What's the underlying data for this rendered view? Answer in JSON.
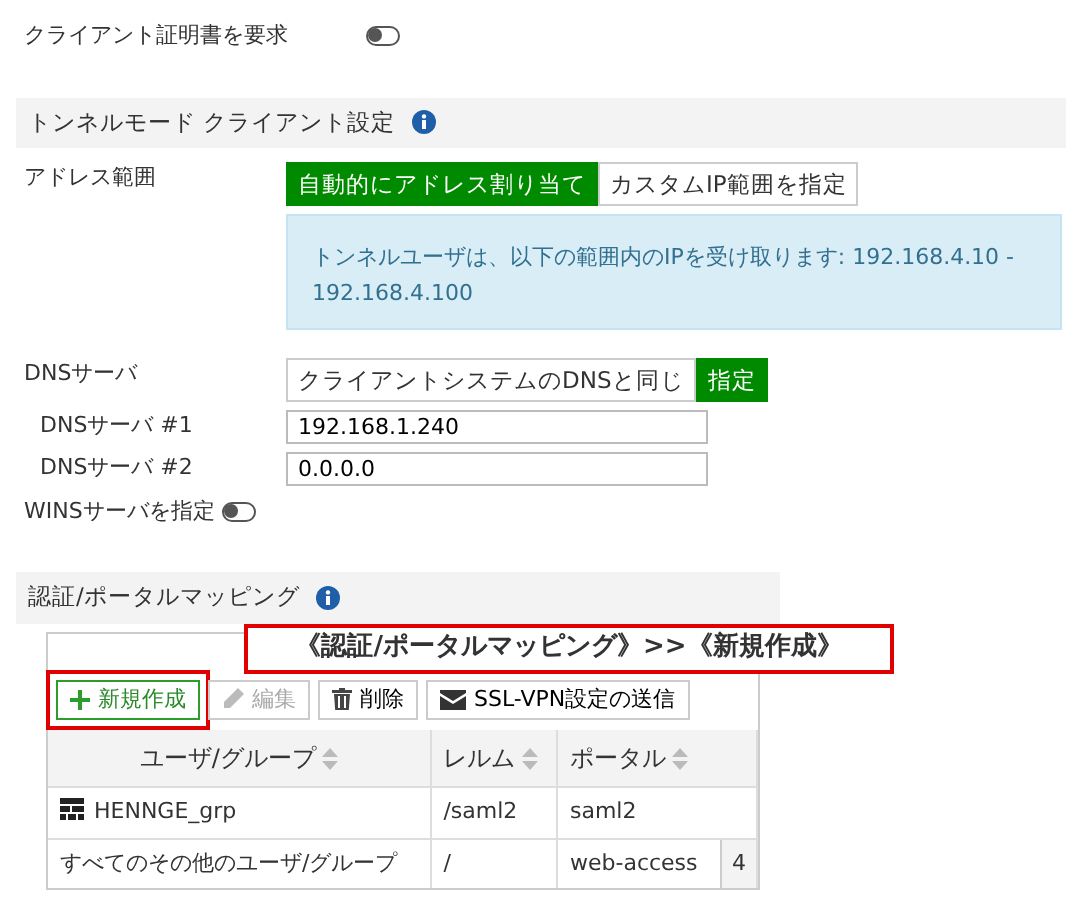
{
  "client_cert": {
    "label": "クライアント証明書を要求",
    "on": false
  },
  "tunnel_section": {
    "title": "トンネルモード クライアント設定"
  },
  "address_range": {
    "label": "アドレス範囲",
    "options": [
      {
        "label": "自動的にアドレス割り当て",
        "selected": true
      },
      {
        "label": "カスタムIP範囲を指定",
        "selected": false
      }
    ],
    "info": "トンネルユーザは、以下の範囲内のIPを受け取ります: 192.168.4.10 - 192.168.4.100"
  },
  "dns": {
    "label": "DNSサーバ",
    "options": [
      {
        "label": "クライアントシステムのDNSと同じ",
        "selected": false
      },
      {
        "label": "指定",
        "selected": true
      }
    ],
    "servers": [
      {
        "label": "DNSサーバ #1",
        "value": "192.168.1.240"
      },
      {
        "label": "DNSサーバ #2",
        "value": "0.0.0.0"
      }
    ]
  },
  "wins": {
    "label": "WINSサーバを指定",
    "on": false
  },
  "mapping": {
    "title": "認証/ポータルマッピング",
    "toolbar": [
      {
        "label": "新規作成",
        "kind": "create",
        "disabled": false,
        "highlighted": true
      },
      {
        "label": "編集",
        "kind": "edit",
        "disabled": true,
        "highlighted": false
      },
      {
        "label": "削除",
        "kind": "delete",
        "disabled": false,
        "highlighted": false
      },
      {
        "label": "SSL-VPN設定の送信",
        "kind": "send",
        "disabled": false,
        "highlighted": false
      }
    ],
    "columns": [
      "ユーザ/グループ",
      "レルム",
      "ポータル"
    ],
    "rows": [
      {
        "kind": "group",
        "cells": [
          "HENNGE_grp",
          "/saml2",
          "saml2"
        ]
      },
      {
        "kind": "plain",
        "cells": [
          "すべてのその他のユーザ/グループ",
          "/",
          "web-access"
        ],
        "badge": "4"
      }
    ]
  },
  "callout": "《認証/ポータルマッピング》>>《新規作成》"
}
